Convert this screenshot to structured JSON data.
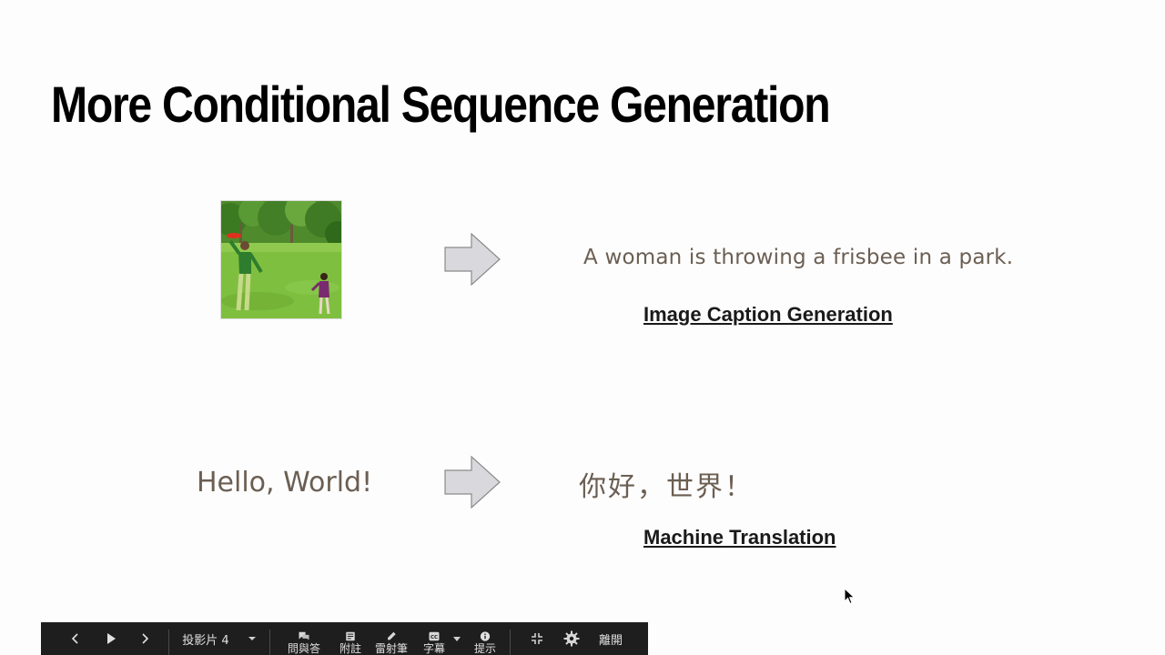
{
  "slide": {
    "title": "More Conditional Sequence Generation",
    "image_caption": {
      "output_text": "A woman is throwing a frisbee in a park.",
      "task_label": "Image Caption Generation"
    },
    "translation": {
      "input_text": "Hello, World!",
      "output_text": "你好，世界！",
      "task_label": "Machine Translation"
    }
  },
  "toolbar": {
    "slide_selector_label": "投影片 4",
    "qa_label": "問與答",
    "notes_label": "附註",
    "laser_label": "雷射筆",
    "captions_label": "字幕",
    "info_label": "提示",
    "exit_label": "離開"
  },
  "colors": {
    "text_brown": "#6b5e52",
    "toolbar_bg": "#1e1e1e",
    "arrow_fill": "#d9d8dd"
  }
}
